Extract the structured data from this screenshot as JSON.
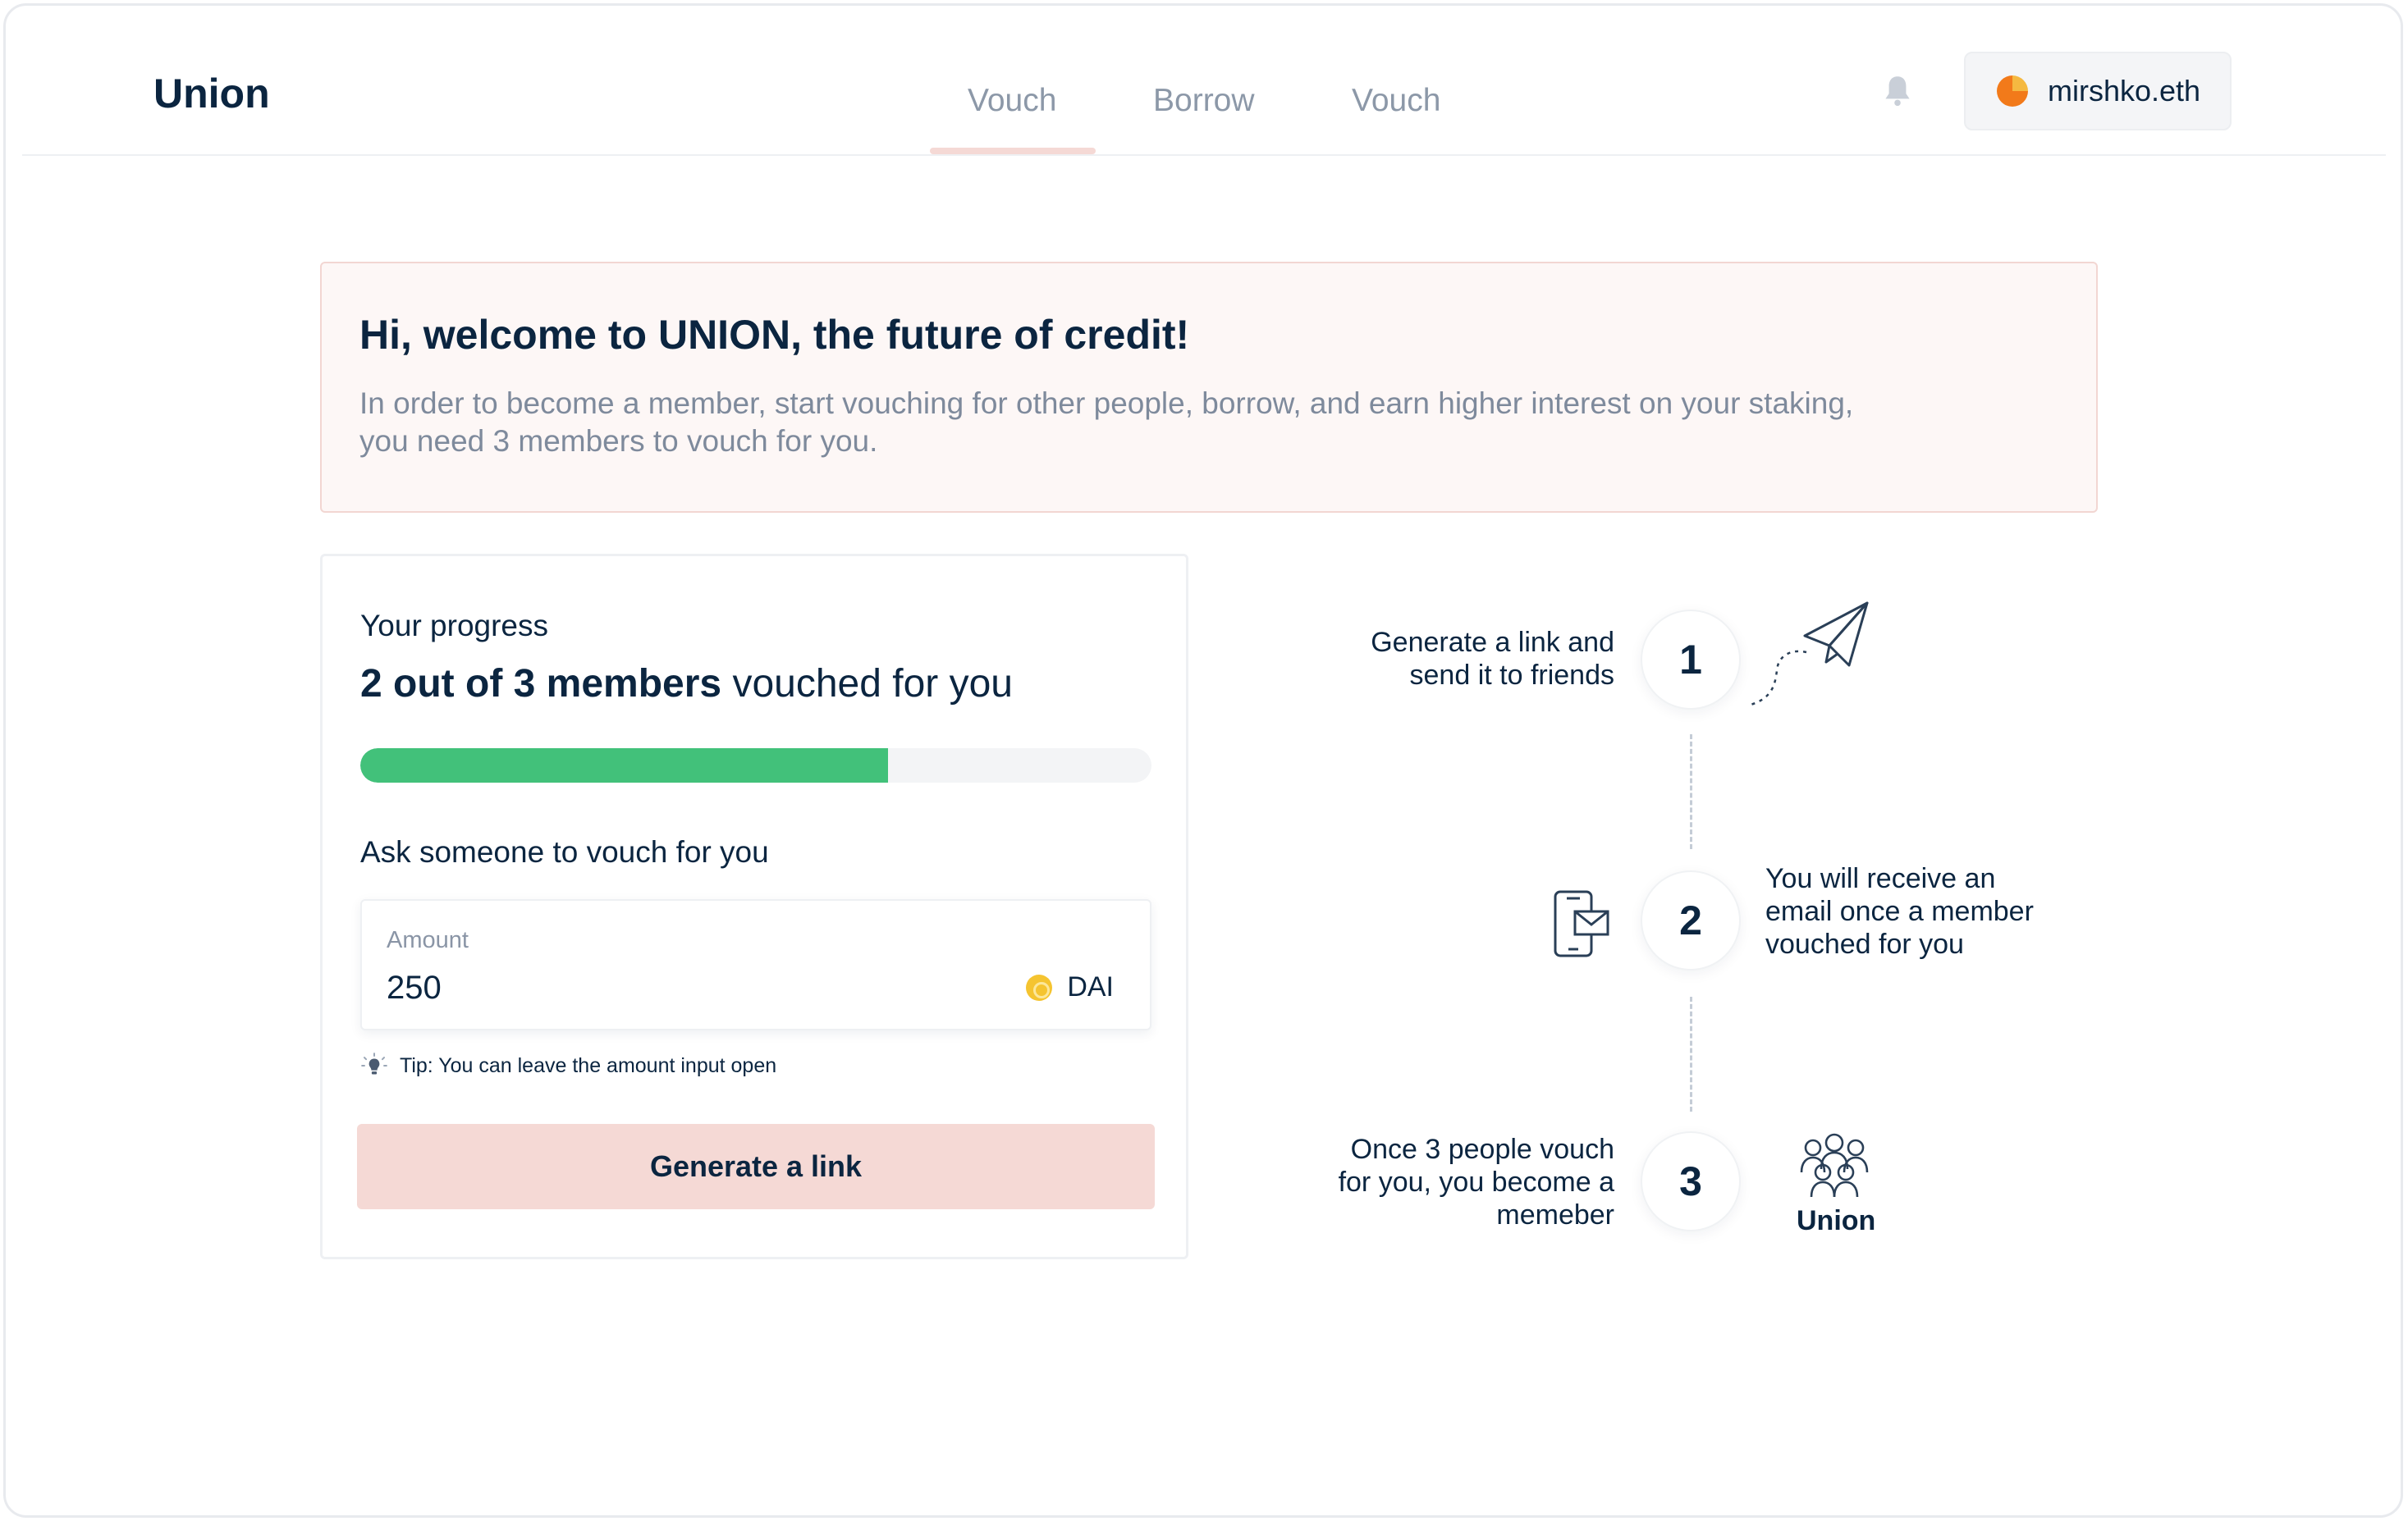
{
  "header": {
    "brand": "Union",
    "tabs": [
      {
        "label": "Vouch",
        "active": true
      },
      {
        "label": "Borrow",
        "active": false
      },
      {
        "label": "Vouch",
        "active": false
      }
    ],
    "wallet": {
      "label": "mirshko.eth"
    }
  },
  "banner": {
    "title": "Hi, welcome to UNION, the future of credit!",
    "body_line1": "In order to become a member, start vouching for other people, borrow, and earn higher interest on your staking,",
    "body_line2": "you need 3 members to vouch for you."
  },
  "progress": {
    "label": "Your progress",
    "summary_bold": "2 out of 3 members",
    "summary_rest": " vouched for you",
    "vouched": 2,
    "required": 3,
    "fill_color": "#42c17a"
  },
  "ask": {
    "label": "Ask someone to vouch for you",
    "amount_caption": "Amount",
    "amount_value": "250",
    "currency": "DAI",
    "tip": "Tip: You can leave the amount input open",
    "button_label": "Generate a link"
  },
  "steps": [
    {
      "number": "1",
      "lines": [
        "Generate a link and",
        "send it to friends"
      ],
      "icon": "paper-plane-icon"
    },
    {
      "number": "2",
      "lines": [
        "You will receive an",
        "email once a member",
        "vouched for you"
      ],
      "icon": "phone-email-icon"
    },
    {
      "number": "3",
      "lines": [
        "Once 3 people vouch",
        "for you, you become a",
        "memeber"
      ],
      "icon": "group-icon"
    }
  ],
  "union_caption": "Union",
  "colors": {
    "accent_pink": "#f5d9d5",
    "banner_bg": "#fdf7f6",
    "text_dark": "#0b2540",
    "text_muted": "#7e8a9c"
  }
}
